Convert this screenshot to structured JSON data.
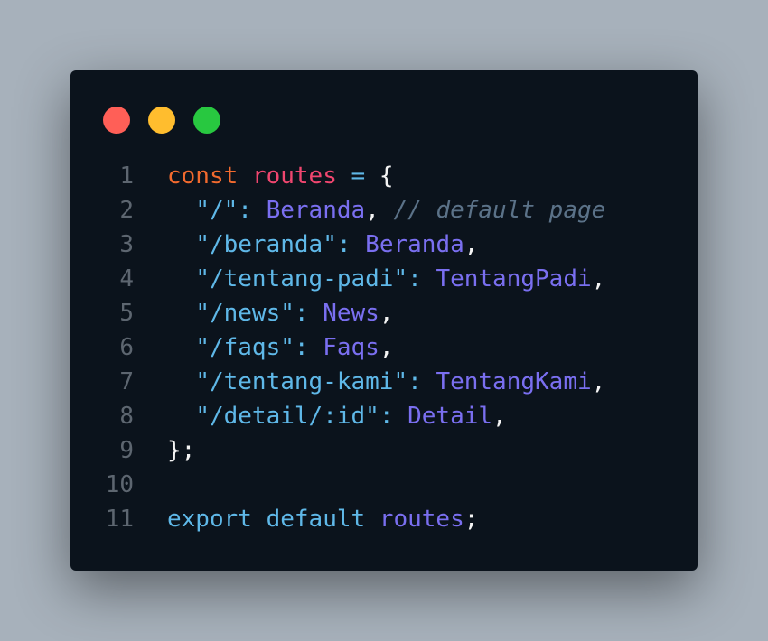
{
  "window_controls": {
    "close_color": "#ff5f57",
    "minimize_color": "#ffbd2e",
    "maximize_color": "#28c840"
  },
  "code": {
    "language": "javascript",
    "lines": [
      {
        "number": "1",
        "tokens": [
          [
            "kw",
            "const"
          ],
          [
            "pun",
            " "
          ],
          [
            "var",
            "routes"
          ],
          [
            "pun",
            " "
          ],
          [
            "op",
            "="
          ],
          [
            "pun",
            " {"
          ]
        ]
      },
      {
        "number": "2",
        "tokens": [
          [
            "pun",
            "  "
          ],
          [
            "str",
            "\"/\""
          ],
          [
            "op",
            ":"
          ],
          [
            "pun",
            " "
          ],
          [
            "id",
            "Beranda"
          ],
          [
            "pun",
            ", "
          ],
          [
            "com",
            "// default page"
          ]
        ]
      },
      {
        "number": "3",
        "tokens": [
          [
            "pun",
            "  "
          ],
          [
            "str",
            "\"/beranda\""
          ],
          [
            "op",
            ":"
          ],
          [
            "pun",
            " "
          ],
          [
            "id",
            "Beranda"
          ],
          [
            "pun",
            ","
          ]
        ]
      },
      {
        "number": "4",
        "tokens": [
          [
            "pun",
            "  "
          ],
          [
            "str",
            "\"/tentang-padi\""
          ],
          [
            "op",
            ":"
          ],
          [
            "pun",
            " "
          ],
          [
            "id",
            "TentangPadi"
          ],
          [
            "pun",
            ","
          ]
        ]
      },
      {
        "number": "5",
        "tokens": [
          [
            "pun",
            "  "
          ],
          [
            "str",
            "\"/news\""
          ],
          [
            "op",
            ":"
          ],
          [
            "pun",
            " "
          ],
          [
            "id",
            "News"
          ],
          [
            "pun",
            ","
          ]
        ]
      },
      {
        "number": "6",
        "tokens": [
          [
            "pun",
            "  "
          ],
          [
            "str",
            "\"/faqs\""
          ],
          [
            "op",
            ":"
          ],
          [
            "pun",
            " "
          ],
          [
            "id",
            "Faqs"
          ],
          [
            "pun",
            ","
          ]
        ]
      },
      {
        "number": "7",
        "tokens": [
          [
            "pun",
            "  "
          ],
          [
            "str",
            "\"/tentang-kami\""
          ],
          [
            "op",
            ":"
          ],
          [
            "pun",
            " "
          ],
          [
            "id",
            "TentangKami"
          ],
          [
            "pun",
            ","
          ]
        ]
      },
      {
        "number": "8",
        "tokens": [
          [
            "pun",
            "  "
          ],
          [
            "str",
            "\"/detail/:id\""
          ],
          [
            "op",
            ":"
          ],
          [
            "pun",
            " "
          ],
          [
            "id",
            "Detail"
          ],
          [
            "pun",
            ","
          ]
        ]
      },
      {
        "number": "9",
        "tokens": [
          [
            "pun",
            "};"
          ]
        ]
      },
      {
        "number": "10",
        "tokens": []
      },
      {
        "number": "11",
        "tokens": [
          [
            "op",
            "export"
          ],
          [
            "pun",
            " "
          ],
          [
            "op",
            "default"
          ],
          [
            "pun",
            " "
          ],
          [
            "id",
            "routes"
          ],
          [
            "pun",
            ";"
          ]
        ]
      }
    ]
  }
}
